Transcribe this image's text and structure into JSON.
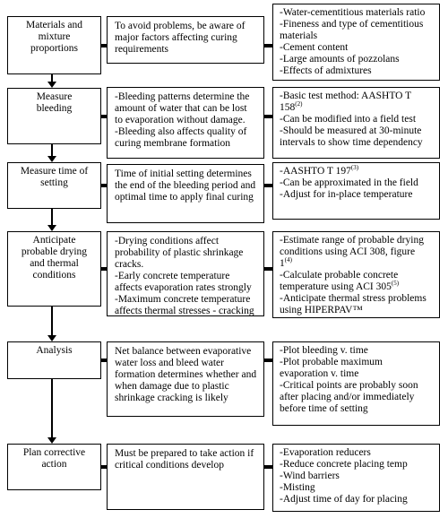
{
  "rows": [
    {
      "step": [
        "Materials and",
        "mixture",
        "proportions"
      ],
      "purpose": [
        "To avoid problems, be aware of",
        "major factors affecting curing",
        "requirements"
      ],
      "details": [
        "-Water-cementitious materials ratio",
        "-Fineness and type of cementitious",
        "materials",
        "-Cement content",
        "-Large amounts of pozzolans",
        "-Effects of admixtures"
      ]
    },
    {
      "step": [
        "Measure",
        "bleeding"
      ],
      "purpose": [
        "-Bleeding patterns determine the",
        "amount of water that can be lost",
        "to evaporation without damage.",
        "-Bleeding also affects quality of",
        "curing membrane formation"
      ],
      "details": [
        "-Basic test method:  AASHTO T",
        "158",
        "-Can be modified into a field test",
        "-Should be measured at 30-minute",
        "intervals to show time dependency"
      ],
      "details_sup": {
        "1": "(2)"
      }
    },
    {
      "step": [
        "Measure time of",
        "setting"
      ],
      "purpose": [
        "Time of initial setting determines",
        "the end of the bleeding period and",
        "optimal time to apply final curing"
      ],
      "details": [
        "-AASHTO T 197",
        "-Can be approximated in the field",
        "-Adjust for in-place temperature"
      ],
      "details_sup": {
        "0": "(3)"
      }
    },
    {
      "step": [
        "Anticipate",
        "probable drying",
        "and thermal",
        "conditions"
      ],
      "purpose": [
        "-Drying conditions affect",
        "probability of plastic shrinkage",
        "cracks.",
        "-Early concrete temperature",
        "affects evaporation rates strongly",
        "-Maximum concrete temperature",
        "affects thermal stresses - cracking"
      ],
      "details": [
        "-Estimate range of probable drying",
        "conditions using ACI 308, figure",
        "1",
        "-Calculate probable concrete",
        "temperature using ACI 305",
        "-Anticipate thermal stress problems",
        "using HIPERPAV™"
      ],
      "details_sup": {
        "2": "(4)",
        "4": "(5)"
      }
    },
    {
      "step": [
        "Analysis"
      ],
      "purpose": [
        "Net balance between evaporative",
        "water loss and bleed water",
        "formation determines whether and",
        "when damage due to plastic",
        "shrinkage cracking is likely"
      ],
      "details": [
        "-Plot bleeding v. time",
        "-Plot probable maximum",
        "evaporation v. time",
        "-Critical points are probably soon",
        "after placing and/or immediately",
        "before time of setting"
      ]
    },
    {
      "step": [
        "Plan corrective",
        "action"
      ],
      "purpose": [
        "Must be prepared to take action if",
        "critical conditions develop"
      ],
      "details": [
        "-Evaporation reducers",
        "-Reduce concrete placing temp",
        "-Wind barriers",
        "-Misting",
        "-Adjust time of day for placing"
      ]
    }
  ]
}
